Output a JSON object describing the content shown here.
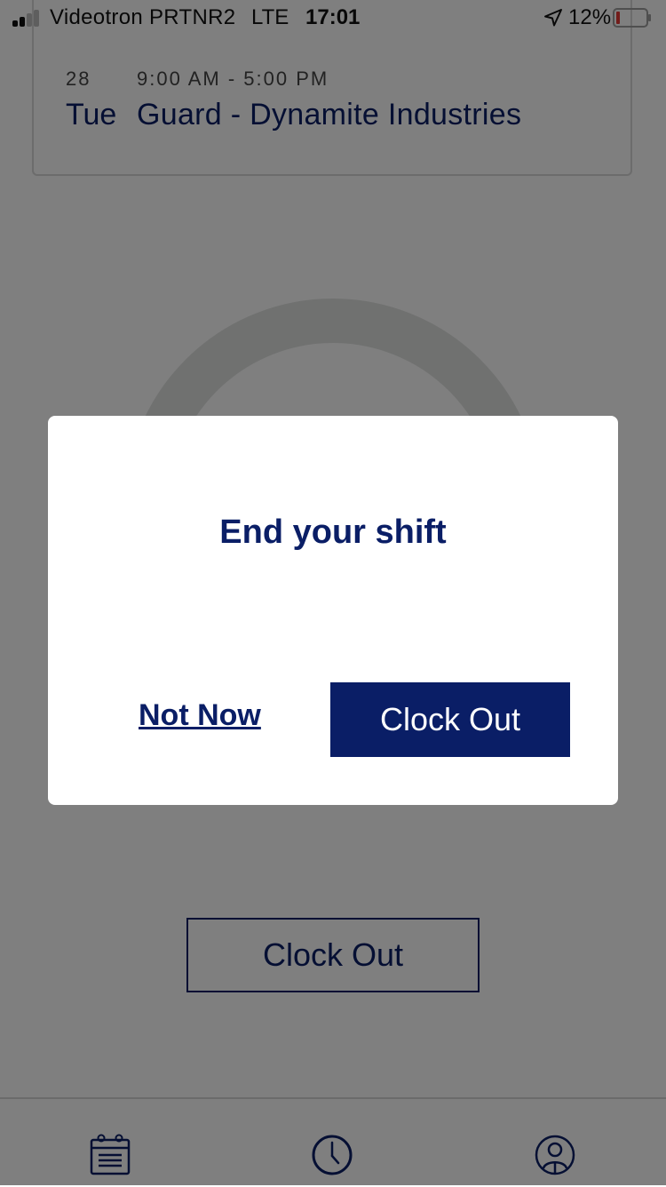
{
  "status_bar": {
    "carrier": "Videotron PRTNR2",
    "network": "LTE",
    "time": "17:01",
    "battery_percent": "12%"
  },
  "shift": {
    "day_number": "28",
    "time_range": "9:00 AM - 5:00 PM",
    "day_name": "Tue",
    "title": "Guard - Dynamite Industries"
  },
  "background": {
    "clock_out_label": "Clock Out"
  },
  "modal": {
    "title": "End your shift",
    "secondary_label": "Not Now",
    "primary_label": "Clock Out"
  },
  "tab_bar": {
    "icons": [
      "calendar-icon",
      "clock-icon",
      "profile-icon"
    ]
  },
  "colors": {
    "brand": "#0a1e66",
    "overlay": "rgba(0,0,0,0.5)",
    "battery_low": "#e53935"
  }
}
